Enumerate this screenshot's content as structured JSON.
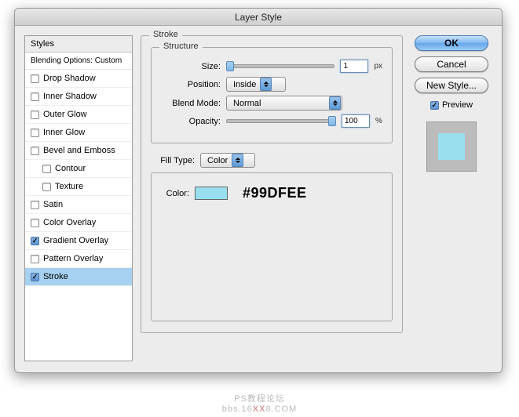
{
  "title": "Layer Style",
  "sidebar": {
    "header": "Styles",
    "subheader": "Blending Options: Custom",
    "items": [
      {
        "label": "Drop Shadow",
        "checked": false
      },
      {
        "label": "Inner Shadow",
        "checked": false
      },
      {
        "label": "Outer Glow",
        "checked": false
      },
      {
        "label": "Inner Glow",
        "checked": false
      },
      {
        "label": "Bevel and Emboss",
        "checked": false
      },
      {
        "label": "Contour",
        "checked": false,
        "indent": true
      },
      {
        "label": "Texture",
        "checked": false,
        "indent": true
      },
      {
        "label": "Satin",
        "checked": false
      },
      {
        "label": "Color Overlay",
        "checked": false
      },
      {
        "label": "Gradient Overlay",
        "checked": true
      },
      {
        "label": "Pattern Overlay",
        "checked": false
      },
      {
        "label": "Stroke",
        "checked": true,
        "selected": true
      }
    ]
  },
  "stroke": {
    "title": "Stroke",
    "structure_title": "Structure",
    "size_label": "Size:",
    "size_value": "1",
    "size_unit": "px",
    "position_label": "Position:",
    "position_value": "Inside",
    "blend_label": "Blend Mode:",
    "blend_value": "Normal",
    "opacity_label": "Opacity:",
    "opacity_value": "100",
    "opacity_unit": "%",
    "filltype_label": "Fill Type:",
    "filltype_value": "Color",
    "color_label": "Color:",
    "color_hex": "#99DFEE"
  },
  "buttons": {
    "ok": "OK",
    "cancel": "Cancel",
    "newstyle": "New Style...",
    "preview": "Preview"
  },
  "watermark": {
    "line1": "PS教程论坛",
    "line2a": "bbs.16",
    "line2x": "XX",
    "line2b": "8.COM"
  }
}
